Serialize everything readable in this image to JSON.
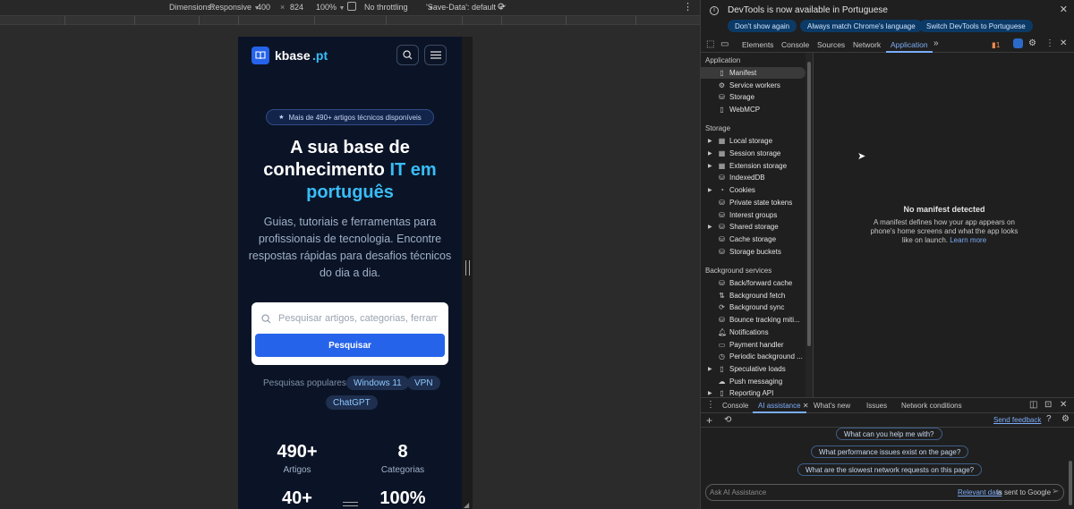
{
  "device_toolbar": {
    "dimensions_label": "Dimensions:",
    "dimensions_value": "Responsive",
    "width": "400",
    "times": "×",
    "height": "824",
    "zoom": "100%",
    "throttling": "No throttling",
    "save_data": "'Save-Data': default"
  },
  "site": {
    "logo_text": "kbase",
    "logo_tld": ".pt",
    "badge": "Mais de 490+ artigos técnicos disponíveis",
    "hero_line1": "A sua base de",
    "hero_line2": "conhecimento",
    "hero_accent1": "IT em",
    "hero_accent2": "português",
    "subtitle": "Guias, tutoriais e ferramentas para profissionais de tecnologia. Encontre respostas rápidas para desafios técnicos do dia a dia.",
    "search_placeholder": "Pesquisar artigos, categorias, ferramentas...",
    "search_button": "Pesquisar",
    "popular_label": "Pesquisas populares:",
    "chips": [
      "Windows 11",
      "VPN",
      "ChatGPT"
    ],
    "stats": [
      {
        "num": "490+",
        "label": "Artigos"
      },
      {
        "num": "8",
        "label": "Categorias"
      },
      {
        "num": "40+",
        "label": ""
      },
      {
        "num": "100%",
        "label": ""
      }
    ]
  },
  "devtools": {
    "infobar_message": "DevTools is now available in Portuguese",
    "infobar_buttons": [
      "Don't show again",
      "Always match Chrome's language",
      "Switch DevTools to Portuguese"
    ],
    "tabs": [
      "Elements",
      "Console",
      "Sources",
      "Network",
      "Application"
    ],
    "active_tab": "Application",
    "issues_count": "1",
    "sidebar": {
      "application_header": "Application",
      "application_items": [
        "Manifest",
        "Service workers",
        "Storage",
        "WebMCP"
      ],
      "storage_header": "Storage",
      "storage_items": [
        "Local storage",
        "Session storage",
        "Extension storage",
        "IndexedDB",
        "Cookies",
        "Private state tokens",
        "Interest groups",
        "Shared storage",
        "Cache storage",
        "Storage buckets"
      ],
      "background_header": "Background services",
      "background_items": [
        "Back/forward cache",
        "Background fetch",
        "Background sync",
        "Bounce tracking miti...",
        "Notifications",
        "Payment handler",
        "Periodic background ...",
        "Speculative loads",
        "Push messaging",
        "Reporting API"
      ]
    },
    "manifest_title": "No manifest detected",
    "manifest_desc": "A manifest defines how your app appears on phone's home screens and what the app looks like on launch.",
    "manifest_link": "Learn more",
    "drawer_tabs": [
      "Console",
      "AI assistance",
      "What's new",
      "Issues",
      "Network conditions"
    ],
    "send_feedback": "Send feedback",
    "suggestions": [
      "What can you help me with?",
      "What performance issues exist on the page?",
      "What are the slowest network requests on this page?"
    ],
    "ai_placeholder": "Ask AI Assistance",
    "relevant_data": "Relevant data",
    "sent_to_google": "is sent to Google"
  }
}
